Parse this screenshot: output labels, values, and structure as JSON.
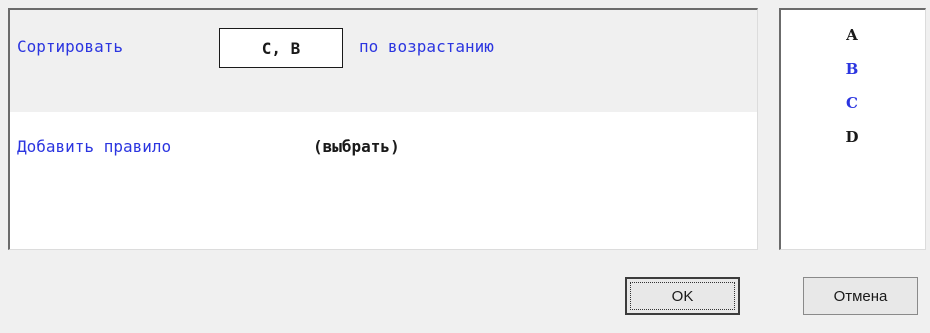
{
  "rules": [
    {
      "prefix": "Сортировать",
      "columns": "C, B",
      "order": "по возрастанию"
    }
  ],
  "add_rule": {
    "label": "Добавить правило",
    "choose": "(выбрать)"
  },
  "columns_list": [
    {
      "name": "A",
      "color": "#1a1a1a"
    },
    {
      "name": "B",
      "color": "#2b35e0"
    },
    {
      "name": "C",
      "color": "#2b35e0"
    },
    {
      "name": "D",
      "color": "#1a1a1a"
    }
  ],
  "buttons": {
    "ok": "OK",
    "cancel": "Отмена"
  },
  "colors": {
    "link": "#2b35e0",
    "text": "#1a1a1a",
    "panel": "#f0f0f0"
  }
}
